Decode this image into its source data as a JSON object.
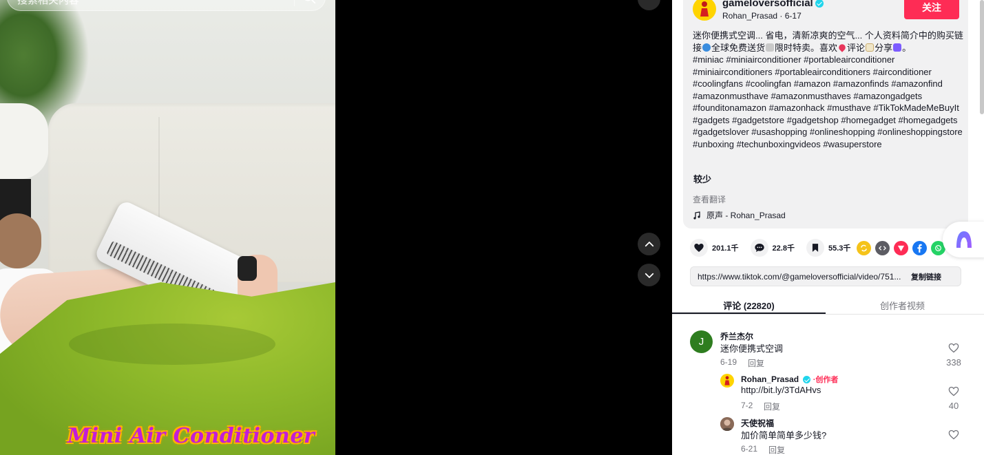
{
  "video": {
    "search_placeholder": "搜索相关内容",
    "caption": "Mini Air Conditioner"
  },
  "post": {
    "author_username": "gameloversofficial",
    "author_display_name": "Rohan_Prasad",
    "post_date": "6-17",
    "follow_label": "关注",
    "description_parts": [
      "迷你便携式空调... 省电，清新凉爽的空气... 个人资料简介中的购买链接",
      "全球免费送货",
      "限时特卖。喜欢",
      "评论",
      "分享",
      "。"
    ],
    "hashtags": "#miniac #miniairconditioner #portableairconditioner #miniairconditioners #portableairconditioners #airconditioner #coolingfans #coolingfan #amazon #amazonfinds #amazonfind #amazonmusthave #amazonmusthaves #amazongadgets #founditonamazon #amazonhack #musthave #TikTokMadeMeBuyIt #gadgets #gadgetstore #gadgetshop #homegadget #homegadgets #gadgetslover #usashopping #onlineshopping #onlineshoppingstore #unboxing #techunboxingvideos #wasuperstore",
    "less_label": "较少",
    "translate_label": "查看翻译",
    "music": "原声 - Rohan_Prasad"
  },
  "actions": {
    "likes": "201.1千",
    "comments": "22.8千",
    "saves": "55.3千"
  },
  "share": {
    "icons": [
      "repost-icon",
      "embed-icon",
      "send-icon",
      "facebook-icon",
      "whatsapp-icon"
    ],
    "colors": {
      "repost": "#f5c31a",
      "embed": "#5c5c63",
      "send": "#fe2c55",
      "facebook": "#1877f2",
      "whatsapp": "#25d366"
    }
  },
  "link": {
    "url": "https://www.tiktok.com/@gameloversofficial/video/751...",
    "copy_label": "复制链接"
  },
  "tabs": [
    {
      "label": "评论 (22820)",
      "active": true
    },
    {
      "label": "创作者视频",
      "active": false
    }
  ],
  "comments": [
    {
      "name": "乔兰杰尔",
      "avatar_letter": "J",
      "avatar_color": "#2e7d1f",
      "text": "迷你便携式空调",
      "date": "6-19",
      "reply_label": "回复",
      "likes": "338"
    },
    {
      "name": "Rohan_Prasad",
      "creator_tag": "·创作者",
      "text": "http://bit.ly/3TdAHvs",
      "date": "7-2",
      "reply_label": "回复",
      "likes": "40"
    },
    {
      "name": "天使祝福",
      "text": "加价简单简单多少钱?",
      "date": "6-21",
      "reply_label": "回复",
      "likes": ""
    }
  ],
  "colors": {
    "accent": "#fe2c55",
    "verified": "#20d5ec",
    "caption_text": "#c21dd8",
    "caption_outline": "#ffb000"
  }
}
